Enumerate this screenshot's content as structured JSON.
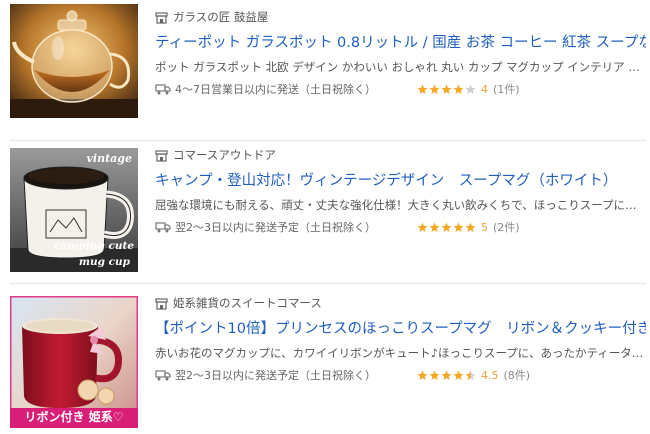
{
  "items": [
    {
      "shop": "ガラスの匠 鼓益屋",
      "title": "ティーポット ガラスポット 0.8リットル / 国産 お茶 コーヒー 紅茶 スープなど",
      "desc": "ポット ガラスポット 北欧 デザイン かわいい おしゃれ 丸い カップ マグカップ インテリア 食器 キッチン 雑貨",
      "shipping": "4〜7日営業日以内に発送（土日祝除く）",
      "rating": 4,
      "rating_text": "4",
      "review_count": "(1件)",
      "image_icon": "glass-teapot-image"
    },
    {
      "shop": "コマースアウトドア",
      "title": "キャンプ・登山対応！ヴィンテージデザイン　スープマグ（ホワイト）",
      "desc": "屈強な環境にも耐える、頑丈・丈夫な強化仕様！大きく丸い飲みくちで、ほっこりスープにも最適です",
      "shipping": "翌2〜3日以内に発送予定（土日祝除く）",
      "rating": 5,
      "rating_text": "5",
      "review_count": "(2件)",
      "image_icon": "vintage-camping-mug-image",
      "image_text": {
        "top": "vintage",
        "bottom1": "camping cute",
        "bottom2": "mug cup"
      }
    },
    {
      "shop": "姫系雑貨のスイートコマース",
      "title": "【ポイント10倍】プリンセスのほっこりスープマグ　リボン＆クッキー付き",
      "desc": "赤いお花のマグカップに、カワイイリボンがキュート♪ほっこりスープに、あったかティータイムにも",
      "shipping": "翌2〜3日以内に発送予定（土日祝除く）",
      "rating": 4.5,
      "rating_text": "4.5",
      "review_count": "(8件)",
      "image_icon": "princess-red-mug-image",
      "image_text": {
        "banner": "リボン付き 姫系♡"
      }
    }
  ],
  "colors": {
    "title": "#1f5fbf",
    "star": "#f5a623",
    "star_empty": "#d0d0d0",
    "score": "#e8a13a"
  }
}
